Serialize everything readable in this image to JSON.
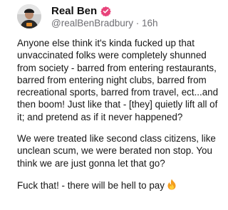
{
  "post": {
    "author": {
      "display_name": "Real Ben",
      "handle": "@realBenBradbury",
      "timestamp": "16h",
      "verified": true
    },
    "separator": " · ",
    "paragraphs": [
      "Anyone else think it's kinda fucked up that unvaccinated folks were completely shunned from society - barred from entering restaurants, barred from entering night clubs, barred from recreational sports, barred from travel, ect...and then boom! Just like that - [they] quietly lift all of it; and pretend as if it never happened?",
      "We were treated like second class citizens, like unclean scum, we were berated non stop. You think we are just gonna let that go?",
      "Fuck that! - there will be hell to pay"
    ],
    "trailing_icon": "fire-emoji",
    "colors": {
      "verified_badge": "#e8437a",
      "handle_text": "#6e6e73",
      "fire": "#f39c1f"
    }
  }
}
